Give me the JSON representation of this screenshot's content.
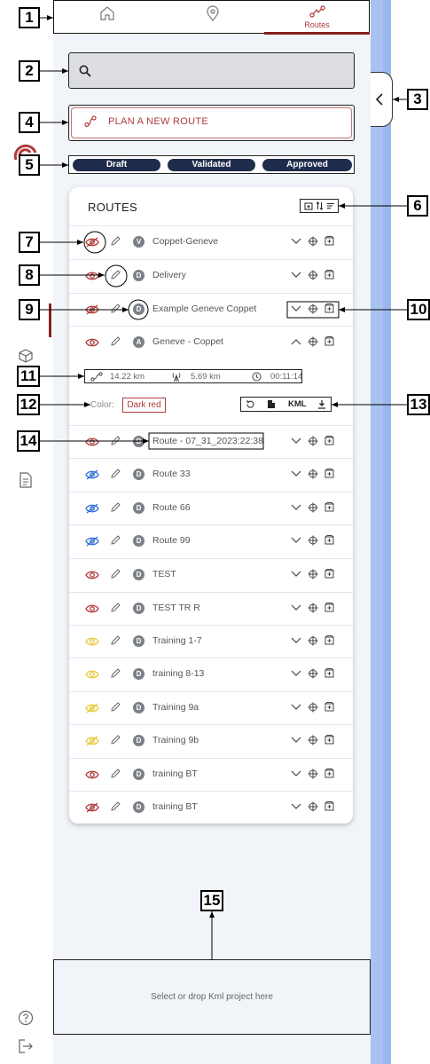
{
  "nav": {
    "tabs": [
      {
        "icon": "home-icon",
        "label": ""
      },
      {
        "icon": "map-pin-icon",
        "label": ""
      },
      {
        "icon": "routes-icon",
        "label": "Routes"
      }
    ]
  },
  "search": {
    "placeholder": ""
  },
  "plan_button": {
    "label": "PLAN A NEW ROUTE"
  },
  "status_filters": [
    "Draft",
    "Validated",
    "Approved"
  ],
  "routes_card": {
    "title": "ROUTES",
    "rows": [
      {
        "name": "Coppet-Geneve",
        "badge": "V",
        "eye": "hidden",
        "eye_color": "#b03a3a"
      },
      {
        "name": "Delivery",
        "badge": "D",
        "eye": "visible",
        "eye_color": "#b03a3a"
      },
      {
        "name": "Example Geneve Coppet",
        "badge": "D",
        "eye": "hidden",
        "eye_color": "#b03a3a"
      },
      {
        "name": "Geneve - Coppet",
        "badge": "A",
        "eye": "visible",
        "eye_color": "#b03a3a",
        "expanded": true
      },
      {
        "name": "Route - 07_31_2023:22:38",
        "badge": "D",
        "eye": "visible",
        "eye_color": "#b03a3a"
      },
      {
        "name": "Route 33",
        "badge": "D",
        "eye": "hidden",
        "eye_color": "#2f6fd6"
      },
      {
        "name": "Route 66",
        "badge": "D",
        "eye": "hidden",
        "eye_color": "#2f6fd6"
      },
      {
        "name": "Route 99",
        "badge": "D",
        "eye": "hidden",
        "eye_color": "#2f6fd6"
      },
      {
        "name": "TEST",
        "badge": "D",
        "eye": "visible",
        "eye_color": "#b03a3a"
      },
      {
        "name": "TEST  TR R",
        "badge": "D",
        "eye": "visible",
        "eye_color": "#b03a3a"
      },
      {
        "name": "Training 1-7",
        "badge": "D",
        "eye": "visible",
        "eye_color": "#e8c93a"
      },
      {
        "name": "training 8-13",
        "badge": "D",
        "eye": "visible",
        "eye_color": "#e8c93a"
      },
      {
        "name": "Training 9a",
        "badge": "D",
        "eye": "hidden",
        "eye_color": "#e8c93a"
      },
      {
        "name": "Training 9b",
        "badge": "D",
        "eye": "hidden",
        "eye_color": "#e8c93a"
      },
      {
        "name": "training BT",
        "badge": "D",
        "eye": "visible",
        "eye_color": "#b03a3a"
      },
      {
        "name": "training BT",
        "badge": "D",
        "eye": "hidden",
        "eye_color": "#b03a3a"
      }
    ],
    "details": {
      "distance_total": "14.22 km",
      "distance_air": "5.69 km",
      "duration": "00:11:14",
      "color_label": "Color:",
      "color_value": "Dark red",
      "kml_label": "KML"
    }
  },
  "dropzone": {
    "text": "Select or drop Kml project here"
  },
  "callouts": [
    "1",
    "2",
    "3",
    "4",
    "5",
    "6",
    "7",
    "8",
    "9",
    "10",
    "11",
    "12",
    "13",
    "14",
    "15"
  ],
  "colors": {
    "accent": "#b03a3a",
    "dark_accent": "#8b1f1f",
    "pill": "#1f2c4c",
    "panel_bg": "#f1f4f8",
    "side_blue": "#a9c2f1"
  }
}
